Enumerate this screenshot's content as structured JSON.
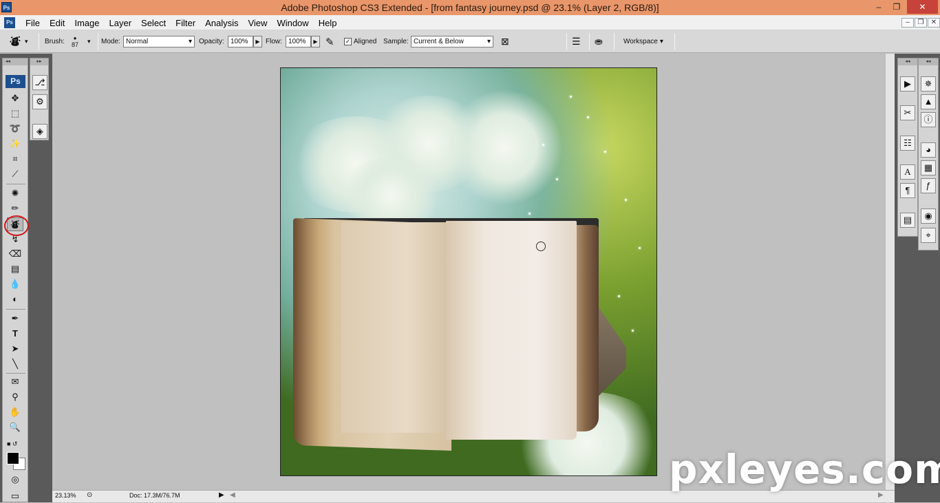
{
  "window": {
    "title": "Adobe Photoshop CS3 Extended - [from fantasy journey.psd @ 23.1% (Layer 2, RGB/8)]",
    "app_icon": "Ps",
    "min": "–",
    "max": "❐",
    "close": "✕"
  },
  "menu": {
    "items": [
      "File",
      "Edit",
      "Image",
      "Layer",
      "Select",
      "Filter",
      "Analysis",
      "View",
      "Window",
      "Help"
    ],
    "doc_min": "–",
    "doc_restore": "❐",
    "doc_close": "✕"
  },
  "options": {
    "brush_label": "Brush:",
    "brush_size": "87",
    "mode_label": "Mode:",
    "mode_value": "Normal",
    "opacity_label": "Opacity:",
    "opacity_value": "100%",
    "flow_label": "Flow:",
    "flow_value": "100%",
    "aligned_label": "Aligned",
    "sample_label": "Sample:",
    "sample_value": "Current & Below",
    "workspace_label": "Workspace"
  },
  "toolbox": {
    "logo": "Ps",
    "highlighted_tool": "clone-stamp-tool"
  },
  "status": {
    "zoom": "23.13%",
    "doc": "Doc: 17.3M/76.7M"
  },
  "watermark": "pxleyes.com",
  "colors": {
    "titlebar": "#e8966a",
    "highlight": "#d0161b",
    "ps_blue": "#1d4f8e"
  }
}
